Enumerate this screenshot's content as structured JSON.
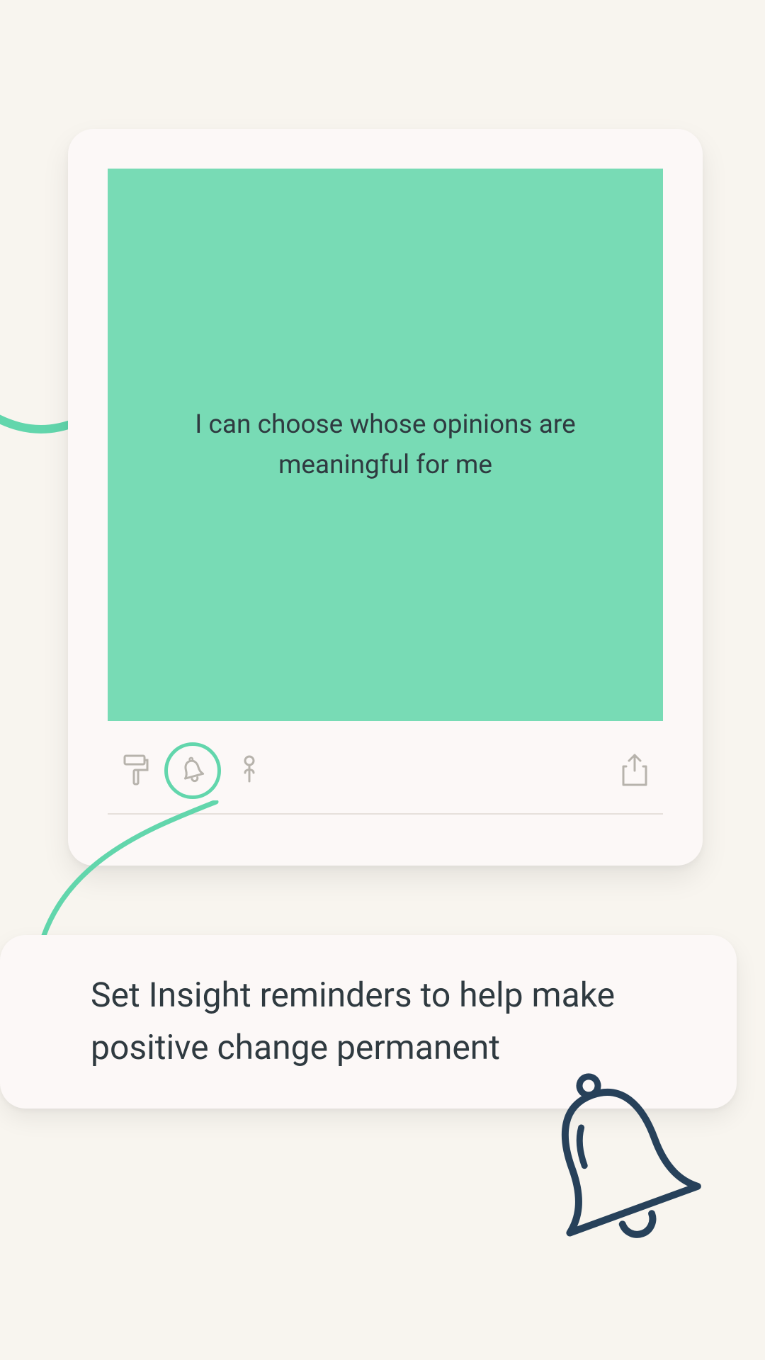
{
  "colors": {
    "background": "#f8f5ef",
    "card": "#fcf8f7",
    "panel": "#78dbb5",
    "accent": "#62d6ac",
    "text": "#2f3a40",
    "iconMuted": "#b7b3ac",
    "iconDark": "#27415a"
  },
  "insight": {
    "text": "I can choose whose opinions are meaningful for me"
  },
  "actions": {
    "paint_icon": "paint-roller-icon",
    "bell_icon": "bell-icon",
    "pin_icon": "pin-icon",
    "share_icon": "share-icon",
    "highlighted": "bell"
  },
  "callout": {
    "text": "Set Insight reminders to help make positive change permanent"
  },
  "decorative": {
    "large_bell_icon": "bell-large-icon"
  }
}
